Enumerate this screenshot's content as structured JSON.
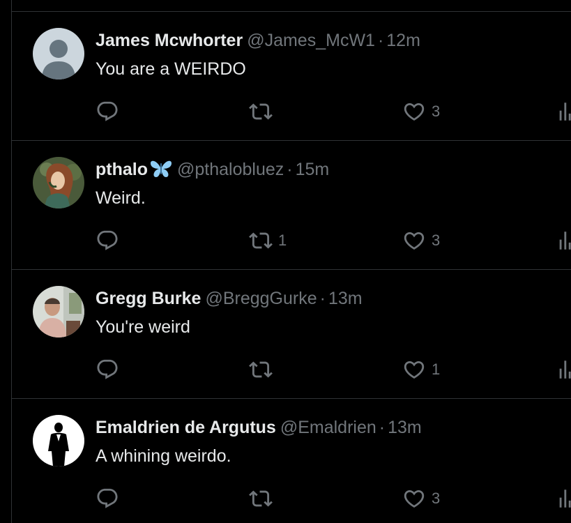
{
  "tweets": [
    {
      "name": "James Mcwhorter",
      "handle": "@James_McW1",
      "dot": "·",
      "time": "12m",
      "text": "You are a WEIRDO",
      "avatar": "default-avatar",
      "replies": "",
      "retweets": "",
      "likes": "3",
      "views": ""
    },
    {
      "name": "pthalo",
      "name_emoji": "butterfly-emoji",
      "handle": "@pthalobluez",
      "dot": "·",
      "time": "15m",
      "text": "Weird.",
      "avatar": "painting-avatar",
      "replies": "",
      "retweets": "1",
      "likes": "3",
      "views": ""
    },
    {
      "name": "Gregg Burke",
      "handle": "@BreggGurke",
      "dot": "·",
      "time": "13m",
      "text": "You're weird",
      "avatar": "photo-avatar",
      "replies": "",
      "retweets": "",
      "likes": "1",
      "views": ""
    },
    {
      "name": "Emaldrien de Argutus",
      "handle": "@Emaldrien",
      "dot": "·",
      "time": "13m",
      "text": "A whining weirdo.",
      "avatar": "silhouette-avatar",
      "replies": "",
      "retweets": "",
      "likes": "3",
      "views": ""
    }
  ],
  "colors": {
    "background": "#000000",
    "text_primary": "#e7e9ea",
    "text_secondary": "#71767b",
    "divider": "#2f3336",
    "butterfly": "#8ecdf5"
  }
}
